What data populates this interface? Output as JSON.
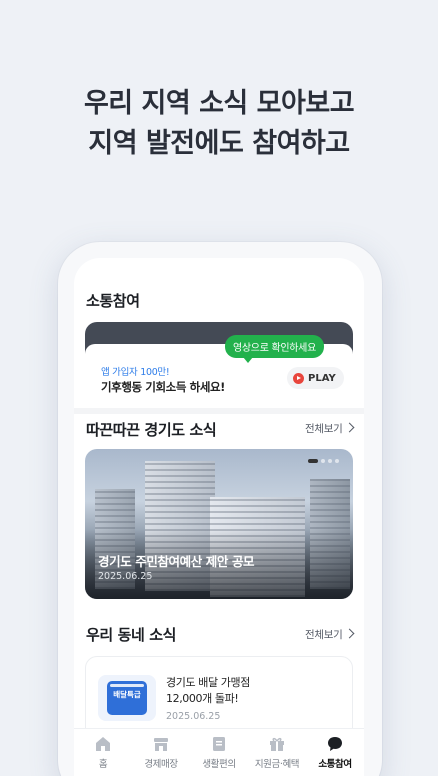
{
  "headline": {
    "line1": "우리 지역 소식 모아보고",
    "line2": "지역 발전에도 참여하고"
  },
  "communication": {
    "title": "소통참여",
    "video_card": {
      "bubble": "영상으로 확인하세요",
      "subtitle": "앱 가입자 100만!",
      "main": "기후행동 기회소득 하세요!",
      "play_label": "PLAY"
    }
  },
  "gyeonggi_news": {
    "title": "따끈따끈 경기도 소식",
    "see_all": "전체보기",
    "banner": {
      "title": "경기도 주민참여예산 제안 공모",
      "date": "2025.06.25",
      "slide_index": 1,
      "slide_count": 4
    }
  },
  "local_news": {
    "title": "우리 동네 소식",
    "see_all": "전체보기",
    "items": [
      {
        "title_line1": "경기도 배달 가맹점",
        "title_line2": "12,000개 돌파!",
        "date": "2025.06.25",
        "thumb_text": "배달특급"
      }
    ]
  },
  "bottom_nav": {
    "items": [
      {
        "label": "홈",
        "icon": "home-icon",
        "active": false
      },
      {
        "label": "경제매장",
        "icon": "store-icon",
        "active": false
      },
      {
        "label": "생활편의",
        "icon": "document-icon",
        "active": false
      },
      {
        "label": "지원금·혜택",
        "icon": "gift-icon",
        "active": false
      },
      {
        "label": "소통참여",
        "icon": "chat-icon",
        "active": true
      }
    ]
  },
  "colors": {
    "background": "#eef1f6",
    "accent_green": "#22b14c",
    "accent_blue": "#2e7de9",
    "play_red": "#e8453c"
  }
}
